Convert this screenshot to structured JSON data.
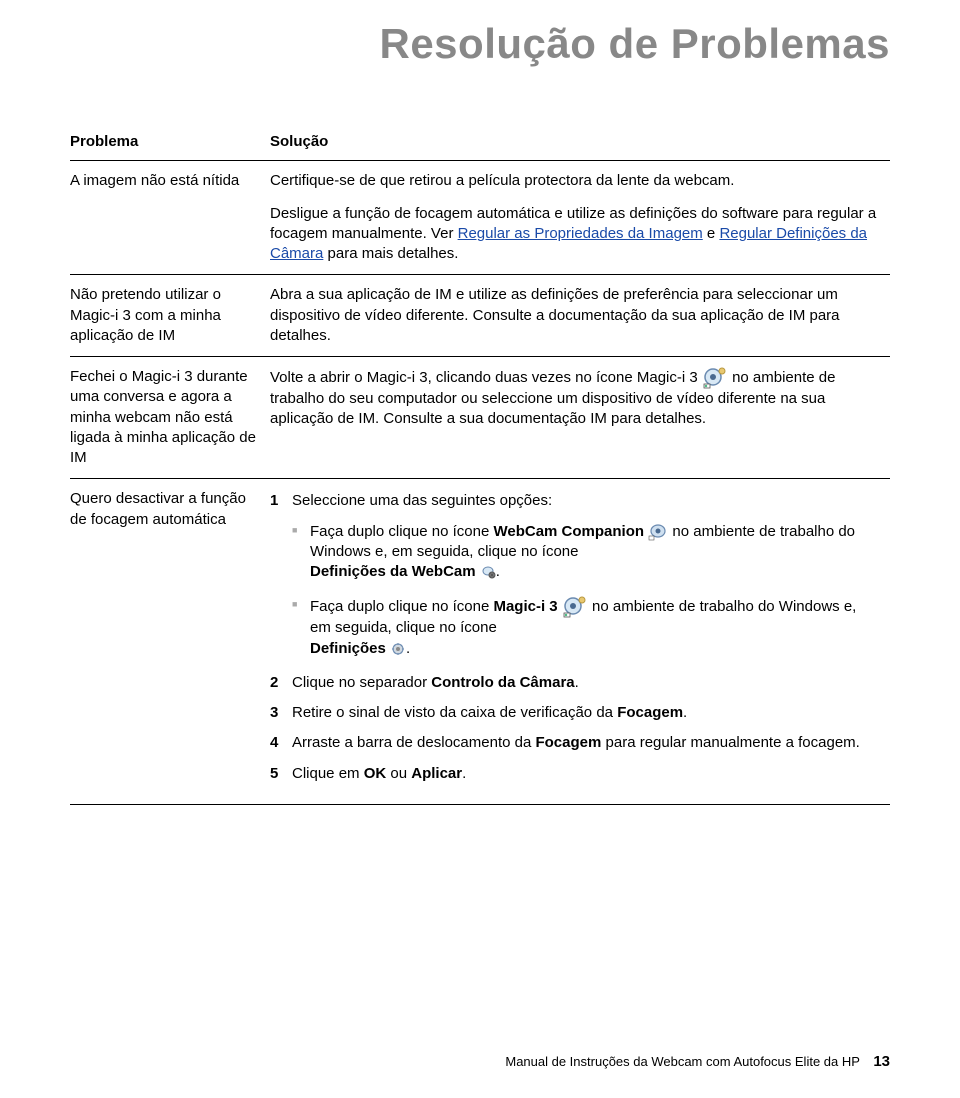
{
  "title": "Resolução de Problemas",
  "headers": {
    "problem": "Problema",
    "solution": "Solução"
  },
  "rows": [
    {
      "problem": "A imagem não está nítida",
      "solution": {
        "p1": "Certifique-se de que retirou a película protectora da lente da webcam.",
        "p2a": "Desligue a função de focagem automática e utilize as definições do software para regular a focagem manualmente. Ver ",
        "link1": "Regular as Propriedades da Imagem",
        "p2b": " e ",
        "link2": "Regular Definições da Câmara",
        "p2c": " para mais detalhes."
      }
    },
    {
      "problem": "Não pretendo utilizar o Magic-i 3 com a minha aplicação de IM",
      "solution": {
        "p1": "Abra a sua aplicação de IM e utilize as definições de preferência para seleccionar um dispositivo de vídeo diferente. Consulte a documentação da sua aplicação de IM para detalhes."
      }
    },
    {
      "problem": "Fechei o Magic-i 3 durante uma conversa e agora a minha webcam não está ligada à minha aplicação de IM",
      "solution": {
        "p1a": "Volte a abrir o Magic-i 3, clicando duas vezes no ícone Magic-i 3 ",
        "p1b": " no ambiente de trabalho do seu computador ou seleccione um dispositivo de vídeo diferente na sua aplicação de IM. Consulte a sua documentação IM para detalhes."
      }
    },
    {
      "problem": "Quero desactivar a função de focagem automática",
      "solution": {
        "step1": "Seleccione uma das seguintes opções:",
        "sub1a": "Faça duplo clique no ícone ",
        "sub1b": "WebCam Companion",
        "sub1c": " no ambiente de trabalho do Windows e, em seguida, clique no ícone ",
        "sub1d": "Definições da WebCam",
        "sub1e": ".",
        "sub2a": "Faça duplo clique no ícone ",
        "sub2b": "Magic-i 3",
        "sub2c": " no ambiente de trabalho do Windows e, em seguida, clique no ícone ",
        "sub2d": "Definições",
        "sub2e": ".",
        "step2a": "Clique no separador ",
        "step2b": "Controlo da Câmara",
        "step2c": ".",
        "step3a": "Retire o sinal de visto da caixa de verificação da ",
        "step3b": "Focagem",
        "step3c": ".",
        "step4a": "Arraste a barra de deslocamento da ",
        "step4b": "Focagem",
        "step4c": " para regular manualmente a focagem.",
        "step5a": "Clique em ",
        "step5b": "OK",
        "step5c": " ou ",
        "step5d": "Aplicar",
        "step5e": "."
      }
    }
  ],
  "footer": {
    "text": "Manual de Instruções da Webcam com Autofocus Elite da HP",
    "page": "13"
  }
}
